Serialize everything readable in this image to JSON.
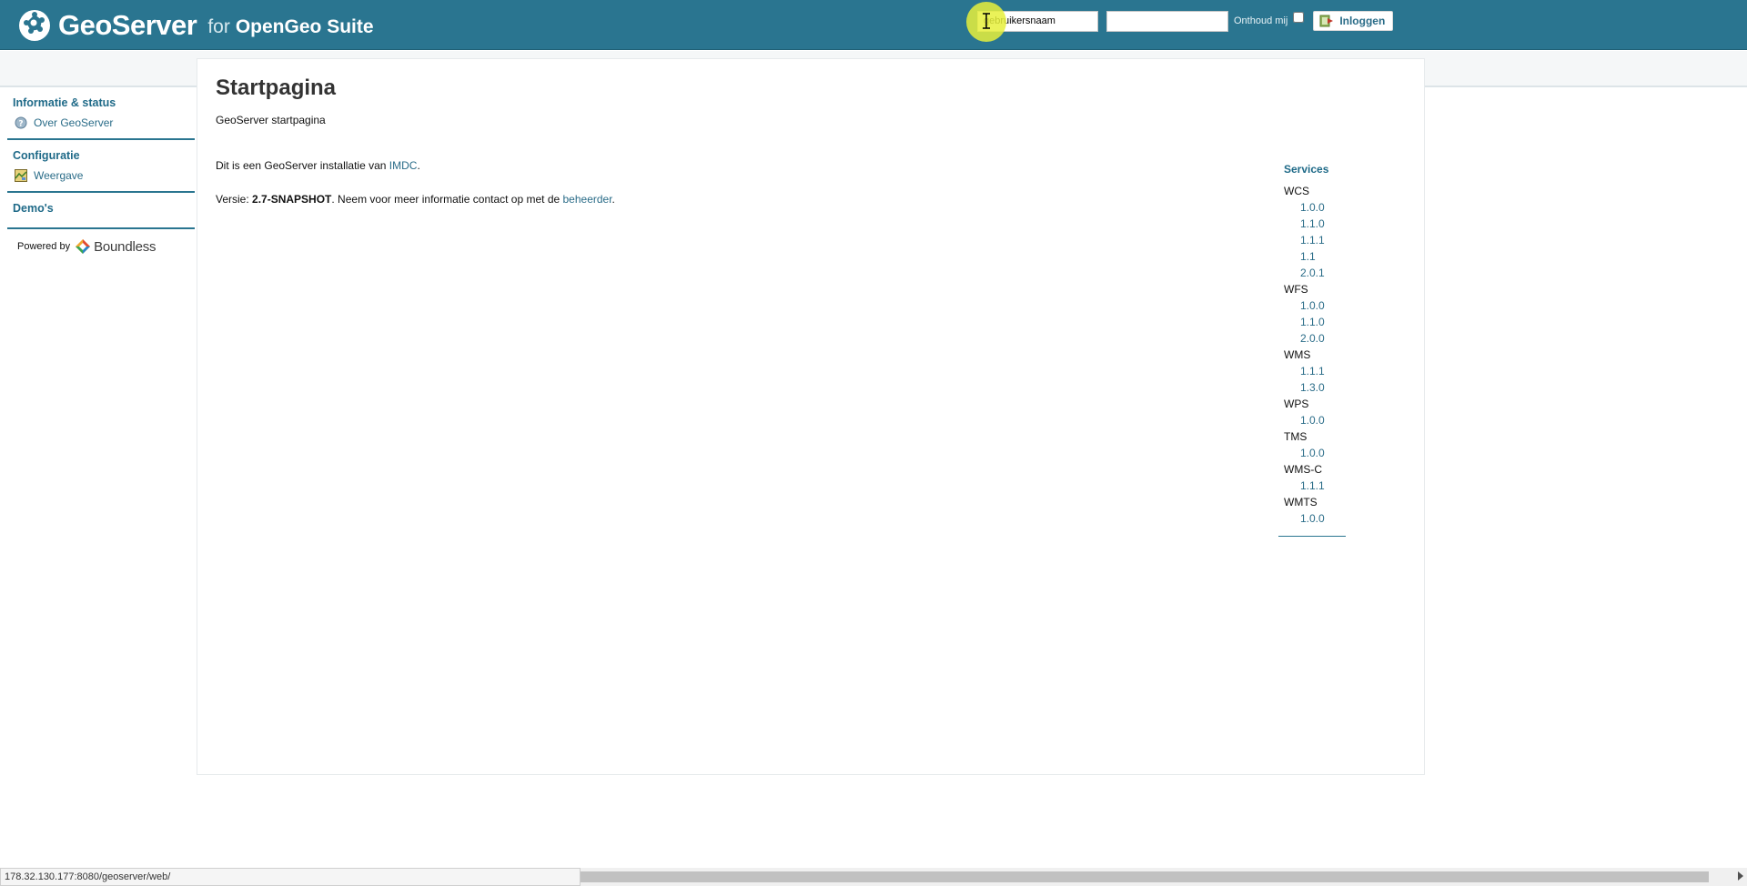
{
  "header": {
    "brand_name": "GeoServer",
    "brand_for": "for",
    "brand_suite": "OpenGeo Suite",
    "login": {
      "username_value": "gebruikersnaam",
      "password_value": "",
      "remember_label": "Onthoud mij",
      "remember_checked": false,
      "login_button": "Inloggen"
    }
  },
  "sidebar": {
    "sections": [
      {
        "title": "Informatie & status",
        "items": [
          {
            "label": "Over GeoServer",
            "icon": "help-icon"
          }
        ]
      },
      {
        "title": "Configuratie",
        "items": [
          {
            "label": "Weergave",
            "icon": "map-icon"
          }
        ]
      },
      {
        "title": "Demo's",
        "items": []
      }
    ],
    "powered_by": "Powered by",
    "powered_brand": "Boundless"
  },
  "main": {
    "title": "Startpagina",
    "subtitle": "GeoServer startpagina",
    "intro_prefix": "Dit is een GeoServer installatie van ",
    "intro_link": "IMDC",
    "intro_suffix": ".",
    "version_prefix": "Versie: ",
    "version_value": "2.7-SNAPSHOT",
    "version_middle": ". Neem voor meer informatie contact op met de ",
    "version_link": "beheerder",
    "version_suffix": "."
  },
  "services": {
    "title": "Services",
    "groups": [
      {
        "name": "WCS",
        "versions": [
          "1.0.0",
          "1.1.0",
          "1.1.1",
          "1.1",
          "2.0.1"
        ]
      },
      {
        "name": "WFS",
        "versions": [
          "1.0.0",
          "1.1.0",
          "2.0.0"
        ]
      },
      {
        "name": "WMS",
        "versions": [
          "1.1.1",
          "1.3.0"
        ]
      },
      {
        "name": "WPS",
        "versions": [
          "1.0.0"
        ]
      },
      {
        "name": "TMS",
        "versions": [
          "1.0.0"
        ]
      },
      {
        "name": "WMS-C",
        "versions": [
          "1.1.1"
        ]
      },
      {
        "name": "WMTS",
        "versions": [
          "1.0.0"
        ]
      }
    ]
  },
  "statusbar": {
    "url": "178.32.130.177:8080/geoserver/web/"
  },
  "colors": {
    "header": "#2a7590",
    "link": "#2a6c88",
    "accent": "#1f6a88"
  }
}
